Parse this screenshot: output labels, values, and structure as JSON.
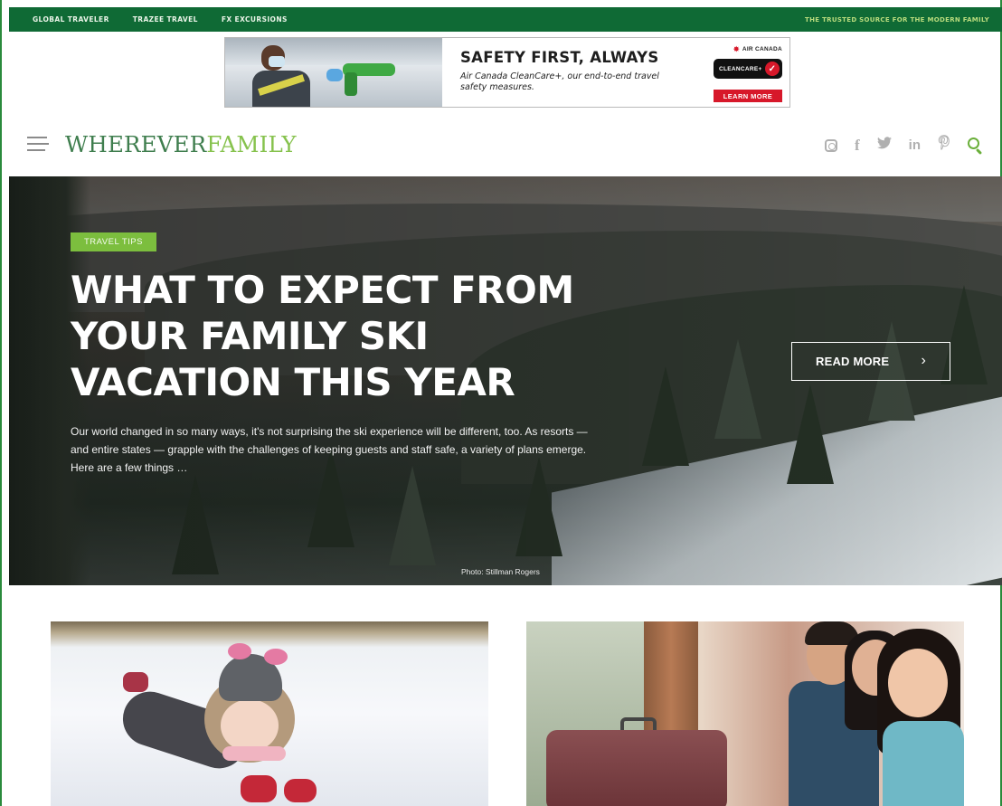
{
  "topbar": {
    "links": [
      "GLOBAL TRAVELER",
      "TRAZEE TRAVEL",
      "FX EXCURSIONS"
    ],
    "tagline": "THE TRUSTED SOURCE FOR THE MODERN FAMILY",
    "background": "#0f6a35"
  },
  "ad": {
    "headline": "SAFETY FIRST, ALWAYS",
    "body": "Air Canada CleanCare+, our end-to-end travel safety measures.",
    "brand": "AIR CANADA",
    "badge": "CLEANCARE+",
    "cta": "LEARN MORE",
    "accent": "#d7182a"
  },
  "header": {
    "logo_first": "WHEREVER",
    "logo_second": "FAMILY",
    "menu_icon": "hamburger-menu-icon",
    "socials": [
      {
        "icon": "instagram-icon",
        "glyph": ""
      },
      {
        "icon": "facebook-icon",
        "glyph": "f"
      },
      {
        "icon": "twitter-icon",
        "glyph": "🐦"
      },
      {
        "icon": "linkedin-icon",
        "glyph": "in"
      },
      {
        "icon": "pinterest-icon",
        "glyph": "℘"
      }
    ],
    "search_icon": "search-icon",
    "colors": {
      "logo_dark": "#3f7e4e",
      "logo_light": "#86c24d",
      "accent": "#6aaf3a"
    }
  },
  "hero": {
    "tag": "TRAVEL TIPS",
    "title_lines": [
      "WHAT TO EXPECT FROM",
      "YOUR FAMILY SKI",
      "VACATION THIS YEAR"
    ],
    "excerpt_lines": [
      "Our world changed in so many ways, it's not surprising the ski experience will be different, too. As resorts —",
      "and entire states — grapple with the challenges of keeping guests and staff safe, a variety of plans emerge.",
      "Here are a few things …"
    ],
    "read_more": "READ MORE",
    "read_more_chevron": "›",
    "photo_credit": "Photo: Stillman Rogers",
    "tag_color": "#7cbe3e"
  },
  "cards": [
    {
      "image": "child-in-snow-photo"
    },
    {
      "image": "family-with-suitcase-photo"
    }
  ]
}
